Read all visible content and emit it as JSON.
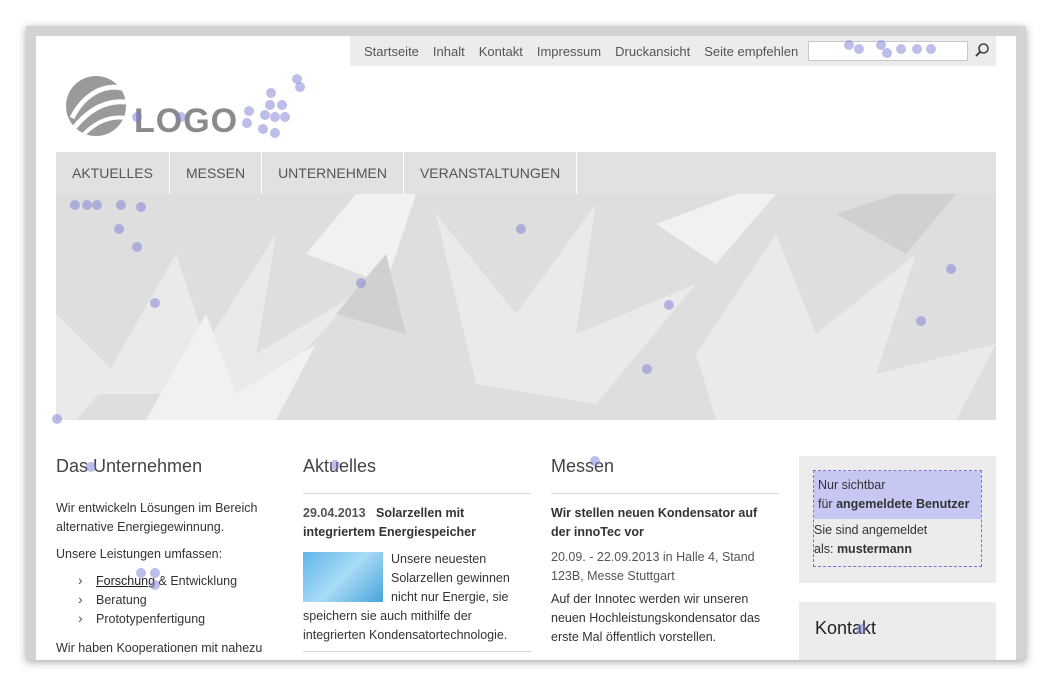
{
  "meta_nav": {
    "items": [
      "Startseite",
      "Inhalt",
      "Kontakt",
      "Impressum",
      "Druckansicht",
      "Seite empfehlen"
    ],
    "search_placeholder": ""
  },
  "logo": {
    "text": "LOGO"
  },
  "main_nav": {
    "items": [
      "AKTUELLES",
      "MESSEN",
      "UNTERNEHMEN",
      "VERANSTALTUNGEN"
    ]
  },
  "unternehmen": {
    "heading": "Das Unternehmen",
    "intro": "Wir entwickeln Lösungen im Bereich alternative Energiegewinnung.",
    "leistungen_label": "Unsere Leistungen umfassen:",
    "leistungen_link": "Forschung",
    "leistungen_rest": " & Entwicklung",
    "leistungen": [
      "Beratung",
      "Prototypenfertigung"
    ],
    "footer": "Wir haben Kooperationen mit nahezu"
  },
  "aktuelles": {
    "heading": "Aktuelles",
    "date": "29.04.2013",
    "title": "Solarzellen mit integriertem Energiespeicher",
    "text": "Unsere neuesten Solarzellen gewinnen nicht nur Energie, sie speichern sie auch mithilfe der integrierten Kondensatortechnologie."
  },
  "messen": {
    "heading": "Messen",
    "title": "Wir stellen neuen Kondensator auf der innoTec vor",
    "meta": "20.09. - 22.09.2013 in Halle 4, Stand 123B, Messe Stuttgart",
    "text": "Auf der Innotec werden wir unseren neuen Hochleistungskondensator das erste Mal öffentlich vorstellen."
  },
  "restricted": {
    "line1": "Nur sichtbar",
    "line2_prefix": "für ",
    "line2_bold": "angemeldete Benutzer",
    "line3": "Sie sind angemeldet",
    "line4_prefix": "als: ",
    "line4_bold": "mustermann"
  },
  "kontakt": {
    "heading": "Kontakt"
  }
}
